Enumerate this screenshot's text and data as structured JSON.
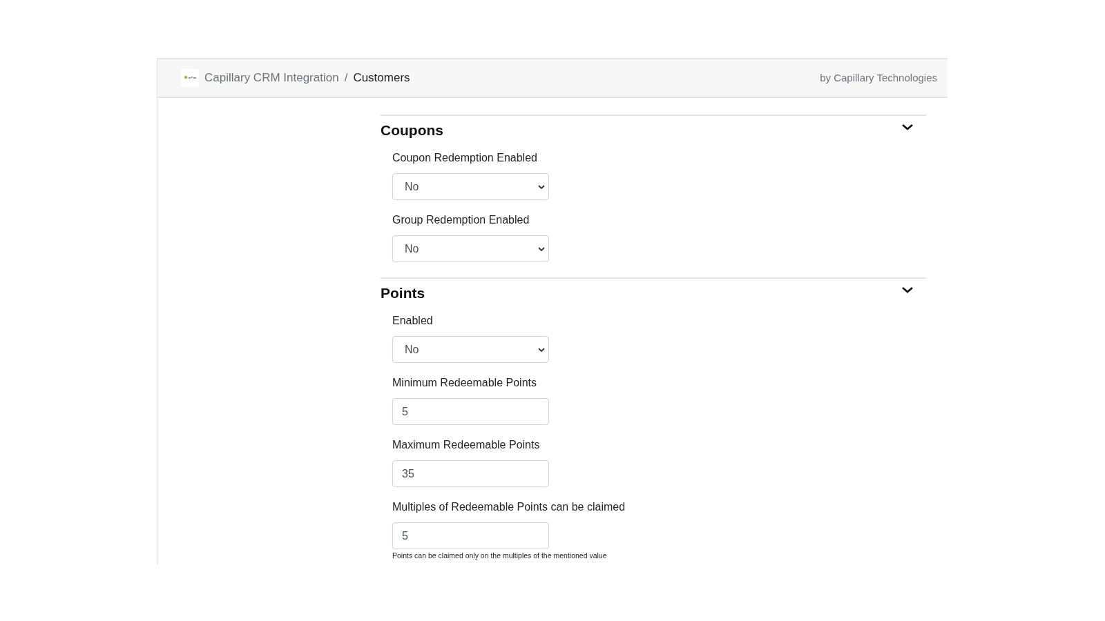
{
  "header": {
    "breadcrumb": [
      "Capillary CRM Integration",
      "Customers"
    ],
    "separator": "/",
    "byline": "by Capillary Technologies"
  },
  "sections": [
    {
      "title": "Coupons",
      "expanded": true,
      "fields": [
        {
          "kind": "select",
          "label": "Coupon Redemption Enabled",
          "value": "No"
        },
        {
          "kind": "select",
          "label": "Group Redemption Enabled",
          "value": "No"
        }
      ]
    },
    {
      "title": "Points",
      "expanded": true,
      "fields": [
        {
          "kind": "select",
          "label": "Enabled",
          "value": "No"
        },
        {
          "kind": "input",
          "label": "Minimum Redeemable Points",
          "value": "5"
        },
        {
          "kind": "input",
          "label": "Maximum Redeemable Points",
          "value": "35"
        },
        {
          "kind": "input",
          "label": "Multiples of Redeemable Points can be claimed",
          "value": "5",
          "hint": "Points can be claimed only on the multiples of the mentioned value"
        }
      ]
    }
  ]
}
